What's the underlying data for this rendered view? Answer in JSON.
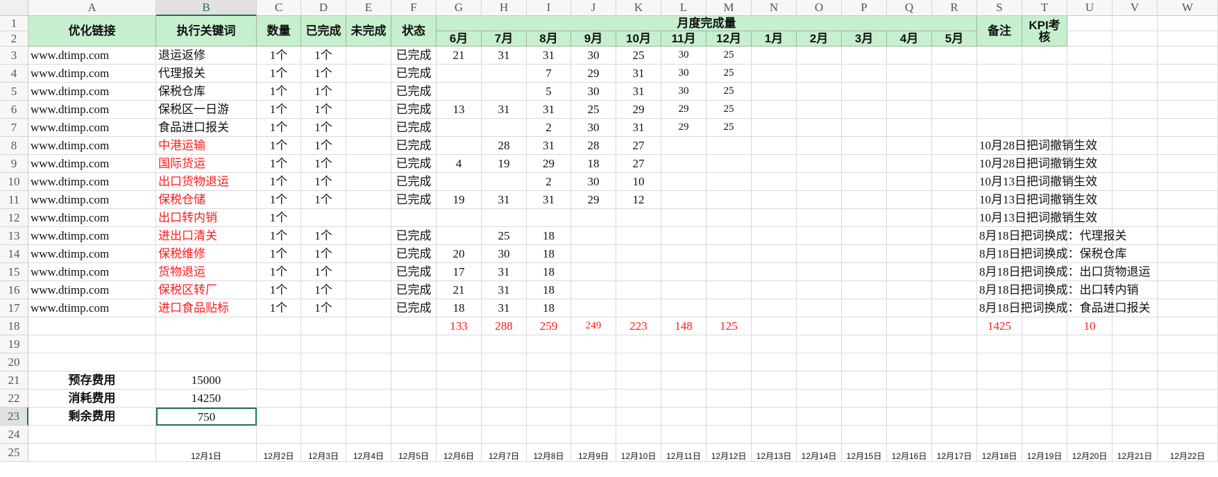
{
  "columns": [
    "A",
    "B",
    "C",
    "D",
    "E",
    "F",
    "G",
    "H",
    "I",
    "J",
    "K",
    "L",
    "M",
    "N",
    "O",
    "P",
    "Q",
    "R",
    "S",
    "T",
    "U",
    "V",
    "W"
  ],
  "rows": [
    "1",
    "2",
    "3",
    "4",
    "5",
    "6",
    "7",
    "8",
    "9",
    "10",
    "11",
    "12",
    "13",
    "14",
    "15",
    "16",
    "17",
    "18",
    "19",
    "20",
    "21",
    "22",
    "23",
    "24",
    "25"
  ],
  "selected_column": "B",
  "selected_row": "23",
  "header": {
    "link": "优化链接",
    "keyword": "执行关键词",
    "qty": "数量",
    "done": "已完成",
    "undone": "未完成",
    "status": "状态",
    "monthly": "月度完成量",
    "months": [
      "6月",
      "7月",
      "8月",
      "9月",
      "10月",
      "11月",
      "12月",
      "1月",
      "2月",
      "3月",
      "4月",
      "5月"
    ],
    "note": "备注",
    "kpi": "KPI考核"
  },
  "records": [
    {
      "link": "www.dtimp.com",
      "keyword": "退运返修",
      "red": false,
      "qty": "1个",
      "done": "1个",
      "status": "已完成",
      "m": [
        "21",
        "31",
        "31",
        "30",
        "25",
        "30",
        "25"
      ],
      "note": ""
    },
    {
      "link": "www.dtimp.com",
      "keyword": "代理报关",
      "red": false,
      "qty": "1个",
      "done": "1个",
      "status": "已完成",
      "m": [
        "",
        "",
        "7",
        "29",
        "31",
        "30",
        "25"
      ],
      "note": ""
    },
    {
      "link": "www.dtimp.com",
      "keyword": "保税仓库",
      "red": false,
      "qty": "1个",
      "done": "1个",
      "status": "已完成",
      "m": [
        "",
        "",
        "5",
        "30",
        "31",
        "30",
        "25"
      ],
      "note": ""
    },
    {
      "link": "www.dtimp.com",
      "keyword": "保税区一日游",
      "red": false,
      "qty": "1个",
      "done": "1个",
      "status": "已完成",
      "m": [
        "13",
        "31",
        "31",
        "25",
        "29",
        "29",
        "25"
      ],
      "note": ""
    },
    {
      "link": "www.dtimp.com",
      "keyword": "食品进口报关",
      "red": false,
      "qty": "1个",
      "done": "1个",
      "status": "已完成",
      "m": [
        "",
        "",
        "2",
        "30",
        "31",
        "29",
        "25"
      ],
      "note": ""
    },
    {
      "link": "www.dtimp.com",
      "keyword": "中港运输",
      "red": true,
      "qty": "1个",
      "done": "1个",
      "status": "已完成",
      "m": [
        "",
        "28",
        "31",
        "28",
        "27",
        "",
        ""
      ],
      "note": "10月28日把词撤销生效"
    },
    {
      "link": "www.dtimp.com",
      "keyword": "国际货运",
      "red": true,
      "qty": "1个",
      "done": "1个",
      "status": "已完成",
      "m": [
        "4",
        "19",
        "29",
        "18",
        "27",
        "",
        ""
      ],
      "note": "10月28日把词撤销生效"
    },
    {
      "link": "www.dtimp.com",
      "keyword": "出口货物退运",
      "red": true,
      "qty": "1个",
      "done": "1个",
      "status": "已完成",
      "m": [
        "",
        "",
        "2",
        "30",
        "10",
        "",
        ""
      ],
      "note": "10月13日把词撤销生效"
    },
    {
      "link": "www.dtimp.com",
      "keyword": "保税仓储",
      "red": true,
      "qty": "1个",
      "done": "1个",
      "status": "已完成",
      "m": [
        "19",
        "31",
        "31",
        "29",
        "12",
        "",
        ""
      ],
      "note": "10月13日把词撤销生效"
    },
    {
      "link": "www.dtimp.com",
      "keyword": "出口转内销",
      "red": true,
      "qty": "1个",
      "done": "",
      "status": "",
      "m": [
        "",
        "",
        "",
        "",
        "",
        "",
        ""
      ],
      "note": "10月13日把词撤销生效"
    },
    {
      "link": "www.dtimp.com",
      "keyword": "进出口清关",
      "red": true,
      "qty": "1个",
      "done": "1个",
      "status": "已完成",
      "m": [
        "",
        "25",
        "18",
        "",
        "",
        "",
        ""
      ],
      "note": "8月18日把词换成：代理报关"
    },
    {
      "link": "www.dtimp.com",
      "keyword": "保税维修",
      "red": true,
      "qty": "1个",
      "done": "1个",
      "status": "已完成",
      "m": [
        "20",
        "30",
        "18",
        "",
        "",
        "",
        ""
      ],
      "note": "8月18日把词换成：保税仓库"
    },
    {
      "link": "www.dtimp.com",
      "keyword": "货物退运",
      "red": true,
      "qty": "1个",
      "done": "1个",
      "status": "已完成",
      "m": [
        "17",
        "31",
        "18",
        "",
        "",
        "",
        ""
      ],
      "note": "8月18日把词换成：出口货物退运"
    },
    {
      "link": "www.dtimp.com",
      "keyword": "保税区转厂",
      "red": true,
      "qty": "1个",
      "done": "1个",
      "status": "已完成",
      "m": [
        "21",
        "31",
        "18",
        "",
        "",
        "",
        ""
      ],
      "note": "8月18日把词换成：出口转内销"
    },
    {
      "link": "www.dtimp.com",
      "keyword": "进口食品贴标",
      "red": true,
      "qty": "1个",
      "done": "1个",
      "status": "已完成",
      "m": [
        "18",
        "31",
        "18",
        "",
        "",
        "",
        ""
      ],
      "note": "8月18日把词换成：食品进口报关"
    }
  ],
  "totals": {
    "m": [
      "133",
      "288",
      "259",
      "249",
      "223",
      "148",
      "125"
    ],
    "sum": "1425",
    "kpi": "10"
  },
  "fees": [
    {
      "label": "预存费用",
      "value": "15000"
    },
    {
      "label": "消耗费用",
      "value": "14250"
    },
    {
      "label": "剩余费用",
      "value": "750"
    }
  ],
  "row25_dates": [
    "12月1日",
    "12月2日",
    "12月3日",
    "12月4日",
    "12月5日",
    "12月6日",
    "12月7日",
    "12月8日",
    "12月9日",
    "12月10日",
    "12月11日",
    "12月12日",
    "12月13日",
    "12月14日",
    "12月15日",
    "12月16日",
    "12月17日",
    "12月18日",
    "12月19日",
    "12月20日",
    "12月21日",
    "12月22日"
  ]
}
